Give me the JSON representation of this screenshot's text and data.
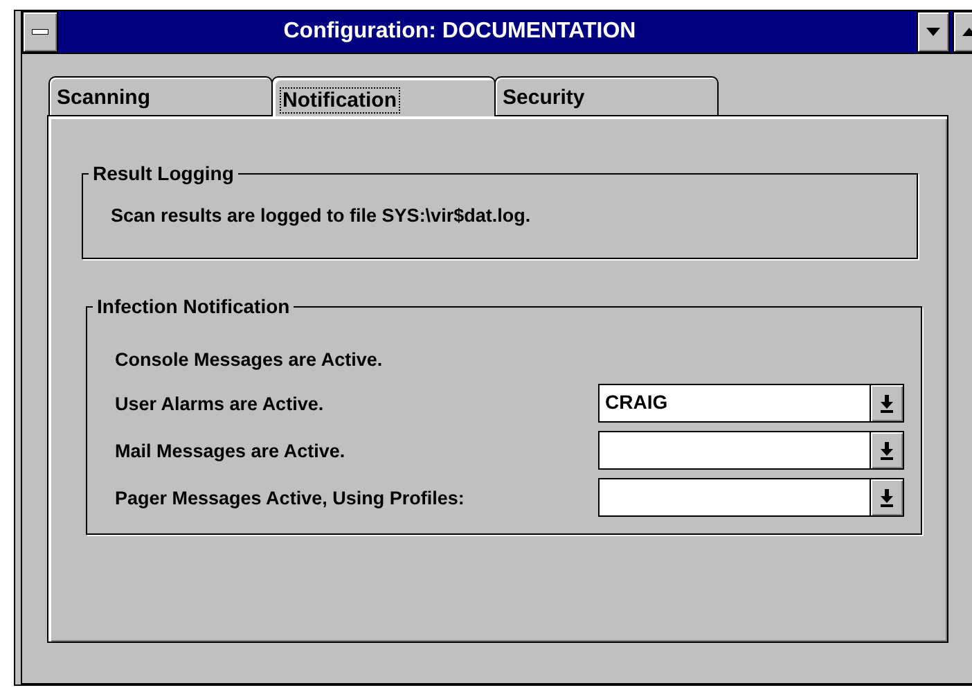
{
  "window": {
    "title": "Configuration: DOCUMENTATION"
  },
  "tabs": [
    {
      "label": "Scanning",
      "selected": false
    },
    {
      "label": "Notification",
      "selected": true
    },
    {
      "label": "Security",
      "selected": false
    }
  ],
  "result_logging": {
    "title": "Result Logging",
    "text": "Scan results are logged to file SYS:\\vir$dat.log."
  },
  "infection_notification": {
    "title": "Infection Notification",
    "rows": [
      {
        "kind": "text",
        "label": "Console Messages are Active."
      },
      {
        "kind": "combo",
        "label": "User Alarms are Active.",
        "value": "CRAIG"
      },
      {
        "kind": "combo",
        "label": "Mail Messages are Active."
      },
      {
        "kind": "combo",
        "label": "Pager Messages Active, Using Profiles:"
      }
    ]
  }
}
